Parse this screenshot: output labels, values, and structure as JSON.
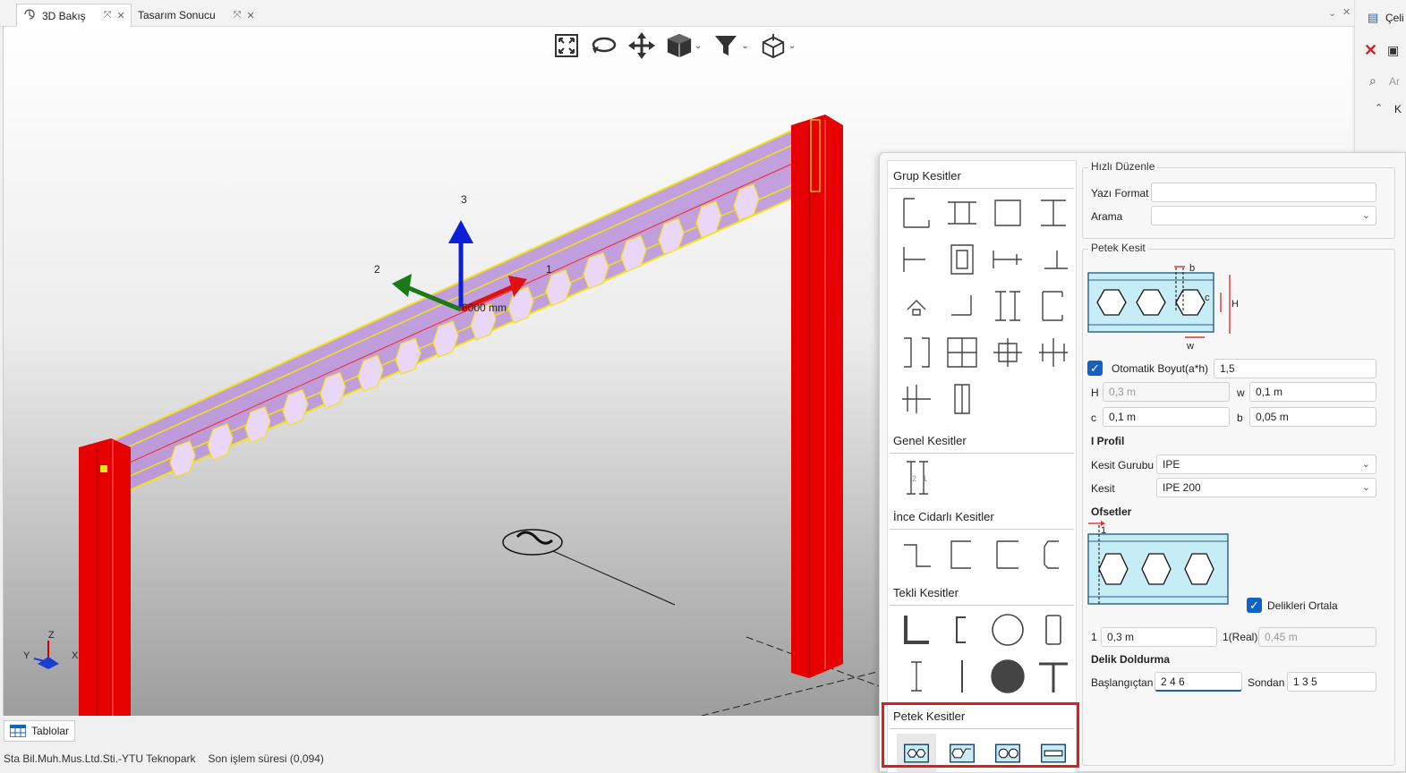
{
  "tabs": [
    {
      "label": "3D Bakış",
      "active": true
    },
    {
      "label": "Tasarım Sonucu",
      "active": false
    }
  ],
  "viewport": {
    "axis_labels": [
      "3",
      "2",
      "1"
    ],
    "dimension_text": "6000 mm",
    "triad": {
      "z": "Z",
      "y": "Y",
      "x": "X"
    }
  },
  "bottom": {
    "tablolar": "Tablolar"
  },
  "status": {
    "company": "Sta Bil.Muh.Mus.Ltd.Sti.-YTU Teknopark",
    "last_op": "Son işlem süresi (0,094)"
  },
  "right_strip": {
    "title_fragment": "Çeli",
    "search_fragment": "Ar",
    "item_fragment": "K"
  },
  "gallery": {
    "group_title": "Grup Kesitler",
    "general_title": "Genel Kesitler",
    "thin_title": "İnce Cidarlı Kesitler",
    "single_title": "Tekli Kesitler",
    "castellated_title": "Petek Kesitler"
  },
  "quick_edit": {
    "legend": "Hızlı Düzenle",
    "format_label": "Yazı Format",
    "format_value": "",
    "search_label": "Arama",
    "search_value": ""
  },
  "petek": {
    "legend": "Petek Kesit",
    "diagram_labels": {
      "b": "b",
      "c": "c",
      "H": "H",
      "w": "w"
    },
    "auto_size_label": "Otomatik Boyut(a*h)",
    "auto_size_checked": true,
    "auto_size_value": "1,5",
    "H_label": "H",
    "H_value": "0,3 m",
    "w_label": "w",
    "w_value": "0,1 m",
    "c_label": "c",
    "c_value": "0,1 m",
    "b_label": "b",
    "b_value": "0,05 m",
    "i_profile_label": "I Profil",
    "group_label": "Kesit Gurubu",
    "group_value": "IPE",
    "section_label": "Kesit",
    "section_value": "IPE 200",
    "offsets_label": "Ofsetler",
    "offset_diagram_label": "1",
    "center_holes_label": "Delikleri Ortala",
    "center_holes_checked": true,
    "offset1_label": "1",
    "offset1_value": "0,3 m",
    "offset1_real_label": "1(Real)",
    "offset1_real_value": "0,45 m",
    "fill_label": "Delik Doldurma",
    "start_label": "Başlangıçtan",
    "start_value": "2 4 6",
    "end_label": "Sondan",
    "end_value": "1 3 5"
  },
  "colors": {
    "accent": "#1262c4",
    "highlight": "#e21b1b",
    "column": "#e60000",
    "beam": "#b98fd8",
    "beam_edge": "#f2e21a"
  }
}
